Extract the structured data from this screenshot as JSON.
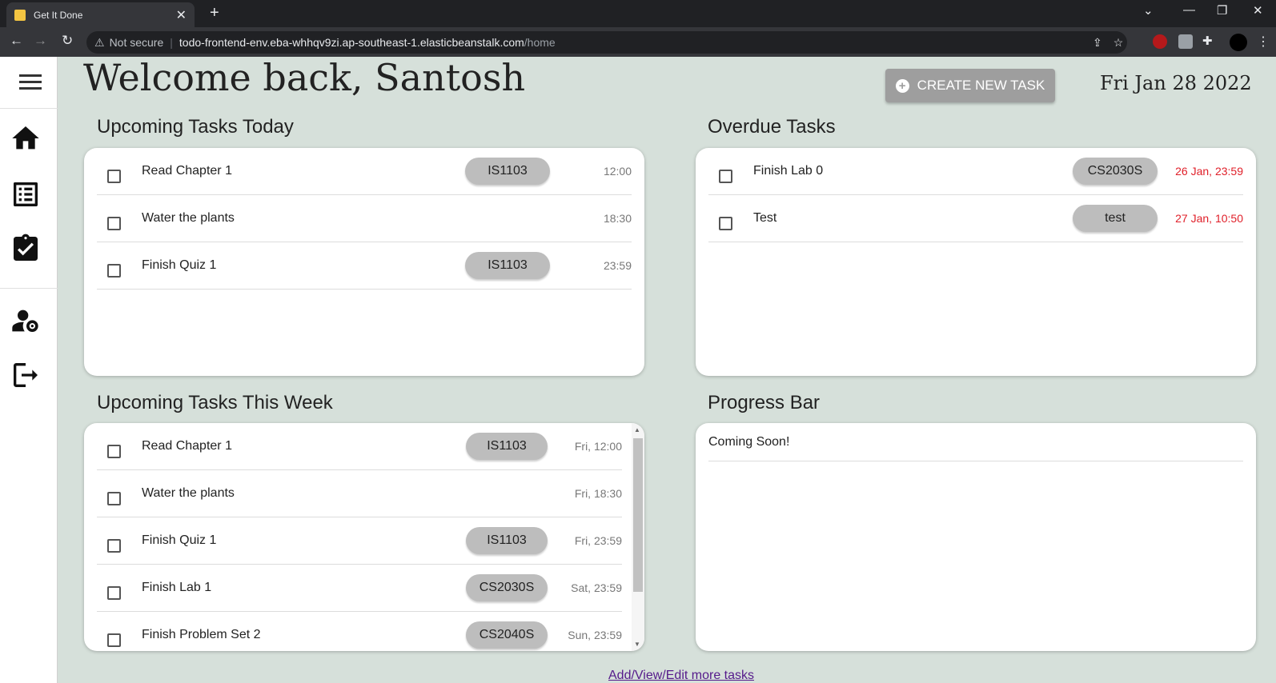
{
  "browser": {
    "tab_title": "Get It Done",
    "security": "Not secure",
    "url_host": "todo-frontend-env.eba-whhqv9zi.ap-southeast-1.elasticbeanstalk.com",
    "url_path": "/home"
  },
  "header": {
    "welcome": "Welcome back, Santosh",
    "create_label": "CREATE NEW TASK",
    "date": "Fri Jan 28 2022"
  },
  "today": {
    "title": "Upcoming Tasks Today",
    "tasks": [
      {
        "name": "Read Chapter 1",
        "tag": "IS1103",
        "time": "12:00"
      },
      {
        "name": "Water the plants",
        "tag": "",
        "time": "18:30"
      },
      {
        "name": "Finish Quiz 1",
        "tag": "IS1103",
        "time": "23:59"
      }
    ]
  },
  "overdue": {
    "title": "Overdue Tasks",
    "tasks": [
      {
        "name": "Finish Lab 0",
        "tag": "CS2030S",
        "time": "26 Jan, 23:59"
      },
      {
        "name": "Test",
        "tag": "test",
        "time": "27 Jan, 10:50"
      }
    ],
    "time_color": "#e0202a"
  },
  "week": {
    "title": "Upcoming Tasks This Week",
    "tasks": [
      {
        "name": "Read Chapter 1",
        "tag": "IS1103",
        "time": "Fri, 12:00"
      },
      {
        "name": "Water the plants",
        "tag": "",
        "time": "Fri, 18:30"
      },
      {
        "name": "Finish Quiz 1",
        "tag": "IS1103",
        "time": "Fri, 23:59"
      },
      {
        "name": "Finish Lab 1",
        "tag": "CS2030S",
        "time": "Sat, 23:59"
      },
      {
        "name": "Finish Problem Set 2",
        "tag": "CS2040S",
        "time": "Sun, 23:59"
      }
    ]
  },
  "progress": {
    "title": "Progress Bar",
    "message": "Coming Soon!"
  },
  "footer": {
    "link": "Add/View/Edit more tasks"
  },
  "colors": {
    "background": "#d6e0da",
    "tag_bg": "#bdbdbd",
    "button_bg": "#9e9e9e"
  }
}
